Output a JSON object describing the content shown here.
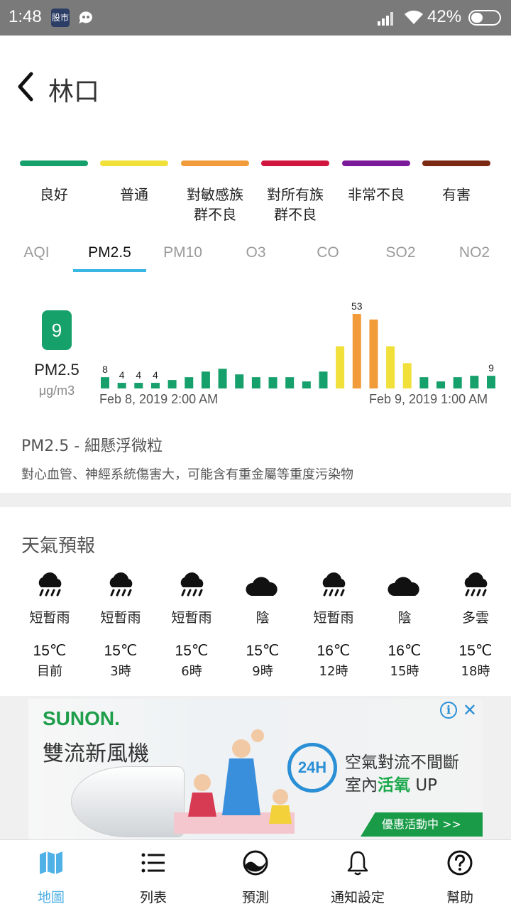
{
  "status_bar": {
    "time": "1:48",
    "app_icon_1": "股市",
    "battery_percent": "42%"
  },
  "header": {
    "title": "林口"
  },
  "legend": [
    {
      "label_line1": "良好",
      "label_line2": "",
      "color": "#15a06c"
    },
    {
      "label_line1": "普通",
      "label_line2": "",
      "color": "#f1e03a"
    },
    {
      "label_line1": "對敏感族",
      "label_line2": "群不良",
      "color": "#f29b3a"
    },
    {
      "label_line1": "對所有族",
      "label_line2": "群不良",
      "color": "#d1163e"
    },
    {
      "label_line1": "非常不良",
      "label_line2": "",
      "color": "#7a1a9a"
    },
    {
      "label_line1": "有害",
      "label_line2": "",
      "color": "#7a2a12"
    }
  ],
  "tabs": [
    "AQI",
    "PM2.5",
    "PM10",
    "O3",
    "CO",
    "SO2",
    "NO2"
  ],
  "active_tab": "PM2.5",
  "current": {
    "value": "9",
    "pollutant": "PM2.5",
    "unit": "μg/m3"
  },
  "chart_data": {
    "type": "bar",
    "values": [
      8,
      4,
      4,
      4,
      6,
      8,
      12,
      14,
      10,
      8,
      8,
      8,
      5,
      12,
      30,
      53,
      49,
      30,
      18,
      8,
      5,
      8,
      9,
      9
    ],
    "colors": [
      "#15a06c",
      "#15a06c",
      "#15a06c",
      "#15a06c",
      "#15a06c",
      "#15a06c",
      "#15a06c",
      "#15a06c",
      "#15a06c",
      "#15a06c",
      "#15a06c",
      "#15a06c",
      "#15a06c",
      "#15a06c",
      "#f1e03a",
      "#f29b3a",
      "#f29b3a",
      "#f1e03a",
      "#f1e03a",
      "#15a06c",
      "#15a06c",
      "#15a06c",
      "#15a06c",
      "#15a06c"
    ],
    "labeled_indices": [
      0,
      1,
      2,
      3,
      15,
      23
    ],
    "start_label": "Feb 8, 2019 2:00 AM",
    "end_label": "Feb 9, 2019 1:00 AM"
  },
  "info": {
    "title": "PM2.5 - 細懸浮微粒",
    "desc": "對心血管、神經系統傷害大，可能含有重金屬等重度污染物"
  },
  "forecast": {
    "title": "天氣預報",
    "items": [
      {
        "icon": "rain-cloud-icon",
        "cond": "短暫雨",
        "temp": "15℃",
        "time": "目前"
      },
      {
        "icon": "rain-cloud-icon",
        "cond": "短暫雨",
        "temp": "15℃",
        "time": "3時"
      },
      {
        "icon": "rain-cloud-icon",
        "cond": "短暫雨",
        "temp": "15℃",
        "time": "6時"
      },
      {
        "icon": "cloud-icon",
        "cond": "陰",
        "temp": "15℃",
        "time": "9時"
      },
      {
        "icon": "rain-cloud-icon",
        "cond": "短暫雨",
        "temp": "16℃",
        "time": "12時"
      },
      {
        "icon": "cloud-icon",
        "cond": "陰",
        "temp": "16℃",
        "time": "15時"
      },
      {
        "icon": "rain-cloud-icon",
        "cond": "多雲",
        "temp": "15℃",
        "time": "18時"
      }
    ]
  },
  "ad": {
    "brand": "SUNON.",
    "product": "雙流新風機",
    "badge": "24H",
    "line1": "空氣對流不間斷",
    "line2_prefix": "室內",
    "line2_highlight": "活氧",
    "line2_suffix": "UP",
    "cta": "優惠活動中 >>"
  },
  "bottom_nav": [
    {
      "icon": "map-icon",
      "label": "地圖",
      "active": true
    },
    {
      "icon": "list-icon",
      "label": "列表",
      "active": false
    },
    {
      "icon": "forecast-icon",
      "label": "預測",
      "active": false
    },
    {
      "icon": "bell-icon",
      "label": "通知設定",
      "active": false
    },
    {
      "icon": "help-icon",
      "label": "幫助",
      "active": false
    }
  ]
}
